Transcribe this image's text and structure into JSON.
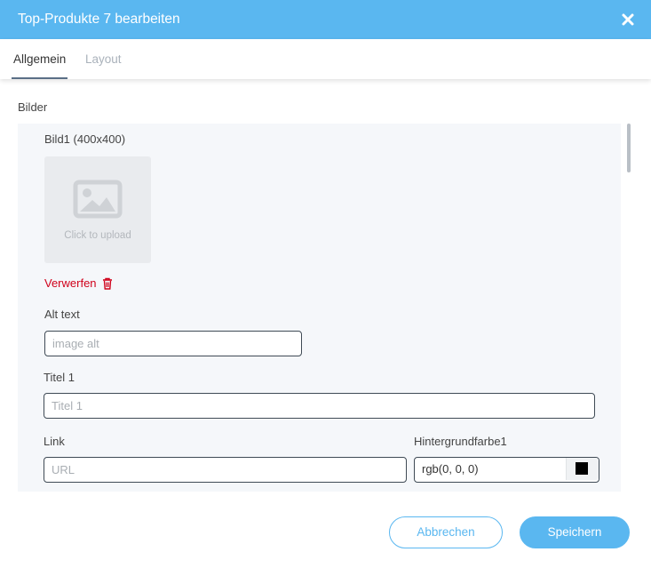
{
  "dialog": {
    "title": "Top-Produkte 7 bearbeiten",
    "header_color": "#5ab7f0"
  },
  "tabs": [
    {
      "label": "Allgemein",
      "active": true
    },
    {
      "label": "Layout",
      "active": false
    }
  ],
  "section": {
    "label": "Bilder"
  },
  "image": {
    "label": "Bild1 (400x400)",
    "upload_text": "Click to upload",
    "upload_icon": "image-placeholder-icon",
    "discard_label": "Verwerfen",
    "discard_icon": "trash-icon",
    "discard_color": "#d0021b"
  },
  "fields": {
    "alt_text": {
      "label": "Alt text",
      "placeholder": "image alt",
      "value": ""
    },
    "title1": {
      "label": "Titel 1",
      "placeholder": "Titel 1",
      "value": ""
    },
    "link": {
      "label": "Link",
      "placeholder": "URL",
      "value": ""
    },
    "bgcolor": {
      "label": "Hintergrundfarbe1",
      "value": "rgb(0, 0, 0)",
      "swatch_color": "#000000"
    }
  },
  "footer": {
    "cancel_label": "Abbrechen",
    "save_label": "Speichern"
  }
}
